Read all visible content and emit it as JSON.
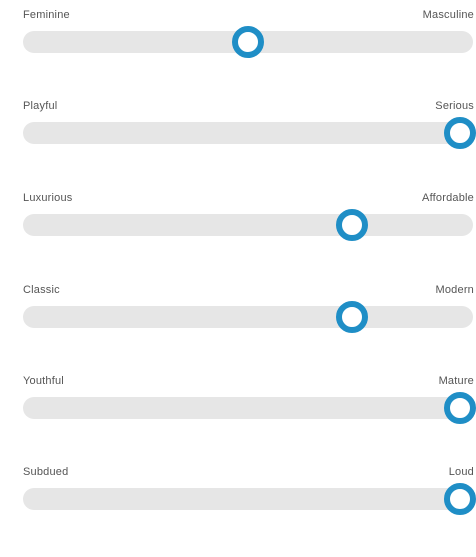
{
  "accent_color": "#1f8ec6",
  "track_color": "#e6e6e6",
  "sliders": [
    {
      "left_label": "Feminine",
      "right_label": "Masculine",
      "value": 0.5
    },
    {
      "left_label": "Playful",
      "right_label": "Serious",
      "value": 0.97
    },
    {
      "left_label": "Luxurious",
      "right_label": "Affordable",
      "value": 0.73
    },
    {
      "left_label": "Classic",
      "right_label": "Modern",
      "value": 0.73
    },
    {
      "left_label": "Youthful",
      "right_label": "Mature",
      "value": 0.97
    },
    {
      "left_label": "Subdued",
      "right_label": "Loud",
      "value": 0.97
    }
  ]
}
